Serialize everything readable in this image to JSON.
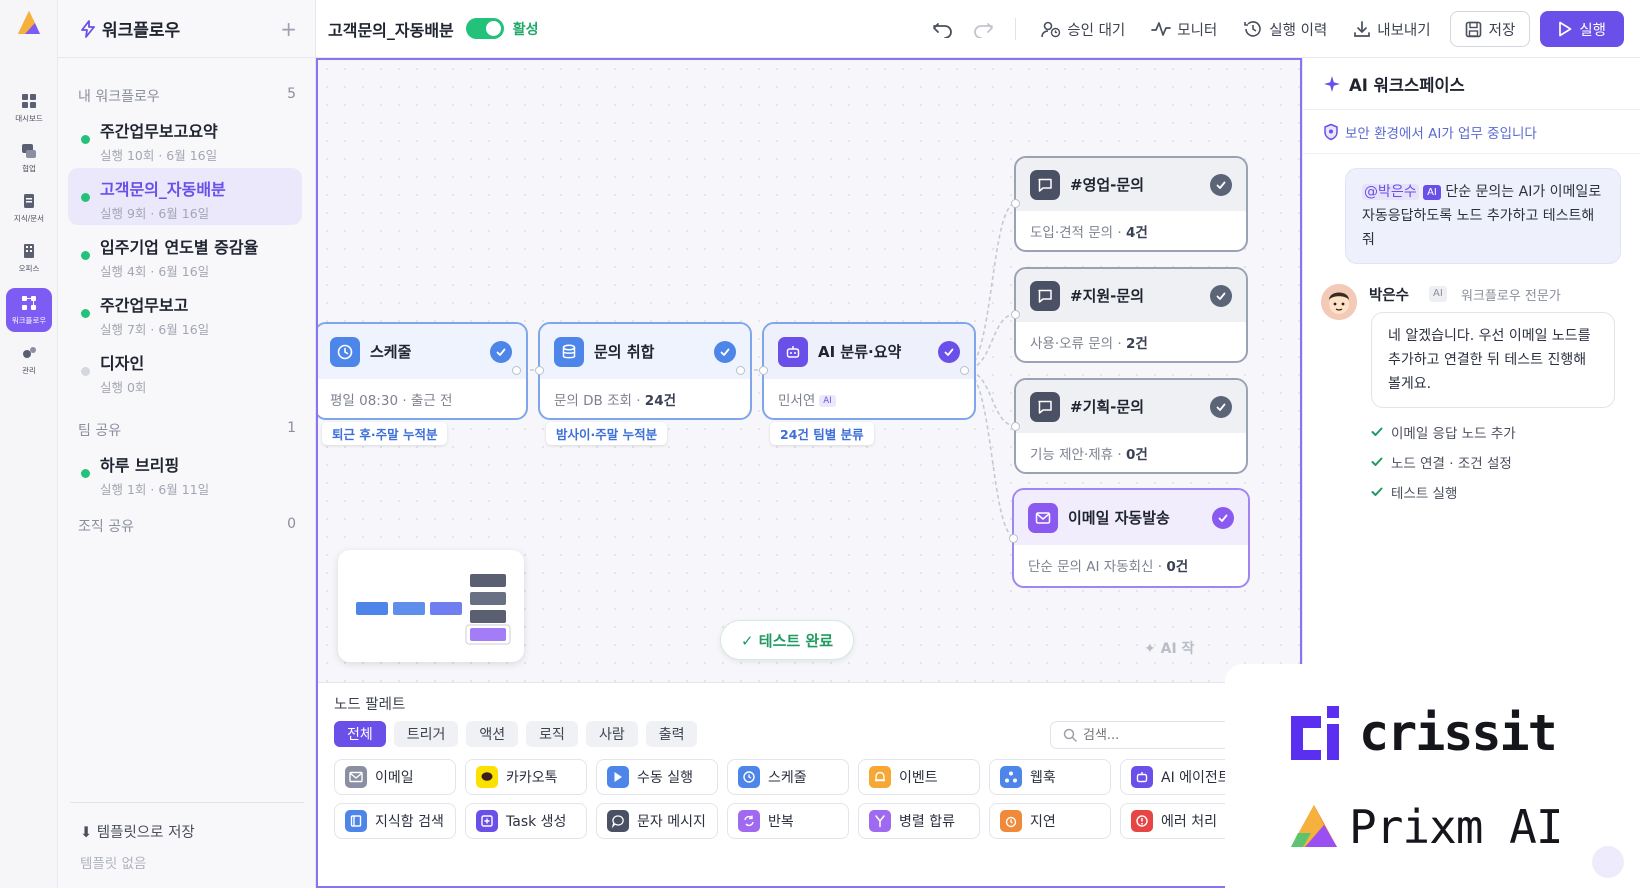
{
  "rail": {
    "items": [
      {
        "label": "대시보드"
      },
      {
        "label": "협업"
      },
      {
        "label": "지식/문서"
      },
      {
        "label": "오피스"
      },
      {
        "label": "워크플로우"
      },
      {
        "label": "관리"
      }
    ]
  },
  "sidebar": {
    "title": "워크플로우",
    "my_section": {
      "label": "내 워크플로우",
      "count": "5"
    },
    "team_section": {
      "label": "팀 공유",
      "count": "1"
    },
    "org_section": {
      "label": "조직 공유",
      "count": "0"
    },
    "workflows": [
      {
        "name": "주간업무보고요약",
        "meta": "실행 10회 · 6월 16일"
      },
      {
        "name": "고객문의_자동배분",
        "meta": "실행 9회 · 6월 16일"
      },
      {
        "name": "입주기업 연도별 증감율",
        "meta": "실행 4회 · 6월 16일"
      },
      {
        "name": "주간업무보고",
        "meta": "실행 7회 · 6월 16일"
      },
      {
        "name": "디자인",
        "meta": "실행 0회"
      }
    ],
    "team_workflows": [
      {
        "name": "하루 브리핑",
        "meta": "실행 1회 · 6월 11일"
      }
    ],
    "save_template": "⬇ 템플릿으로 저장",
    "no_template": "템플릿 없음"
  },
  "topbar": {
    "workflow_title": "고객문의_자동배분",
    "status": "활성",
    "approval": "승인 대기",
    "monitor": "모니터",
    "history": "실행 이력",
    "export": "내보내기",
    "save": "저장",
    "run": "실행"
  },
  "canvas": {
    "nodes": {
      "schedule": {
        "title": "스케줄",
        "desc": "평일 08:30 · 출근 전",
        "pill": "퇴근 후·주말 누적분"
      },
      "collect": {
        "title": "문의 취합",
        "desc_prefix": "문의 DB 조회 · ",
        "desc_count": "24건",
        "pill": "밤사이·주말 누적분"
      },
      "classify": {
        "title": "AI 분류·요약",
        "desc": "민서연",
        "ai_tag": "AI",
        "pill": "24건 팀별 분류"
      },
      "sales": {
        "title": "#영업-문의",
        "desc_prefix": "도입·견적 문의 · ",
        "desc_count": "4건"
      },
      "support": {
        "title": "#지원-문의",
        "desc_prefix": "사용·오류 문의 · ",
        "desc_count": "2건"
      },
      "planning": {
        "title": "#기획-문의",
        "desc_prefix": "기능 제안·제휴 · ",
        "desc_count": "0건"
      },
      "email": {
        "title": "이메일 자동발송",
        "desc_prefix": "단순 문의 AI 자동회신 · ",
        "desc_count": "0건"
      }
    },
    "test_done": "✓ 테스트 완료",
    "ai_ghost": "✦ AI 작"
  },
  "palette": {
    "title": "노드 팔레트",
    "tabs": [
      "전체",
      "트리거",
      "액션",
      "로직",
      "사람",
      "출력"
    ],
    "search_placeholder": "검색...",
    "row1": [
      "이메일",
      "카카오톡",
      "수동 실행",
      "스케줄",
      "이벤트",
      "웹훅",
      "AI 에이전트"
    ],
    "row2": [
      "지식함 검색",
      "Task 생성",
      "문자 메시지",
      "반복",
      "병렬 합류",
      "지연",
      "에러 처리"
    ]
  },
  "panel": {
    "title": "AI 워크스페이스",
    "security_note": "보안 환경에서 AI가 업무 중입니다",
    "user_mention": "@박은수",
    "user_ai_badge": "AI",
    "user_message": " 단순 문의는 AI가 이메일로 자동응답하도록 노드 추가하고 테스트해줘",
    "agent_name": "박은수",
    "agent_badge": "AI",
    "agent_role": "워크플로우 전문가",
    "agent_message": "네 알겠습니다. 우선 이메일 노드를 추가하고 연결한 뒤 테스트 진행해볼게요.",
    "todos": [
      "이메일 응답 노드 추가",
      "노드 연결 · 조건 설정",
      "테스트 실행"
    ]
  },
  "brand": {
    "name1": "crissit",
    "name2": "Prixm AI"
  },
  "colors": {
    "accent": "#6a4fe8",
    "active_green": "#22c27a",
    "node_blue": "#4d86e8",
    "node_purple": "#8a5af0"
  }
}
